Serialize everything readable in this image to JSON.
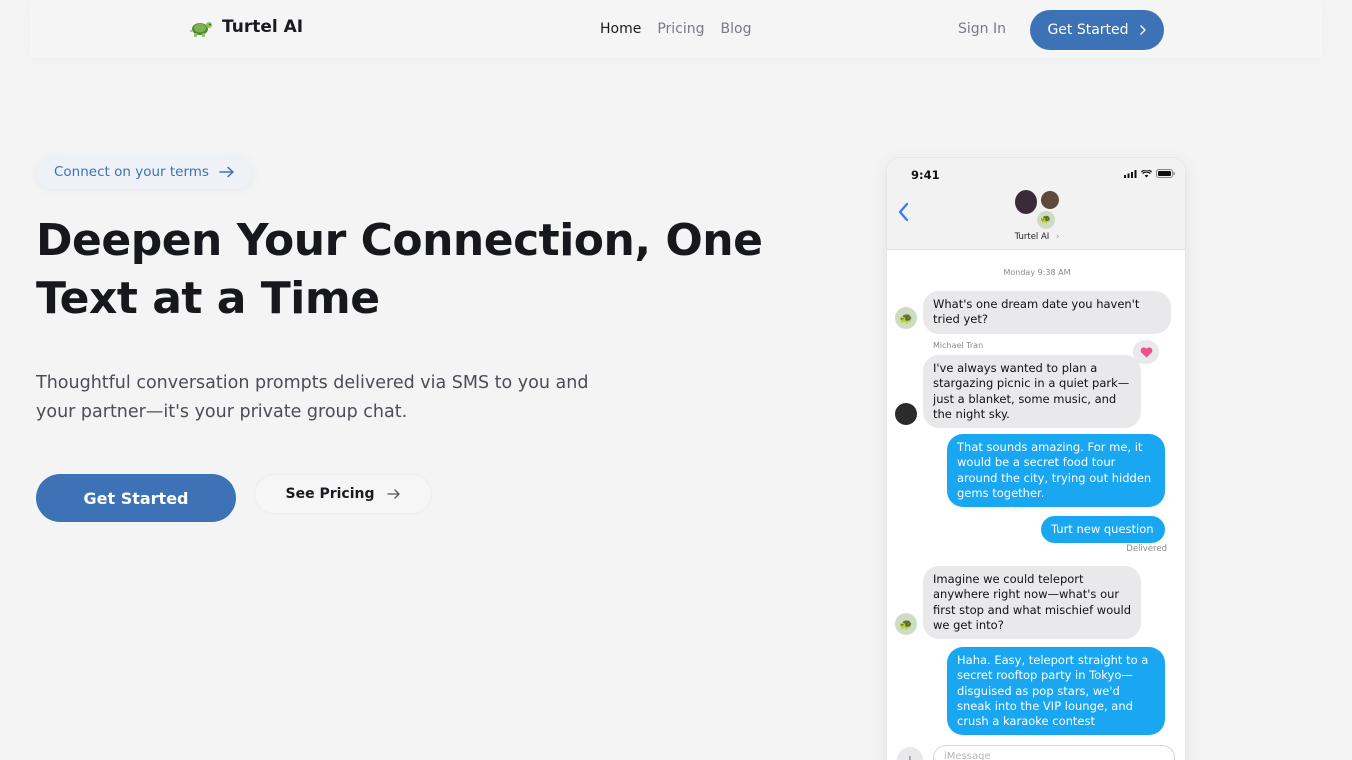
{
  "nav": {
    "brand": "Turtel AI",
    "links": [
      {
        "label": "Home",
        "active": true
      },
      {
        "label": "Pricing",
        "active": false
      },
      {
        "label": "Blog",
        "active": false
      }
    ],
    "sign_in": "Sign In",
    "cta": "Get Started"
  },
  "hero": {
    "pill": "Connect on your terms",
    "headline_line1": "Deepen Your Connection, One",
    "headline_line2": "Text at a Time",
    "subtitle_line1": "Thoughtful conversation prompts delivered via SMS to you and",
    "subtitle_line2": "your partner—it's your private group chat.",
    "primary_cta": "Get Started",
    "secondary_cta": "See Pricing"
  },
  "phone": {
    "time": "9:41",
    "contact_name": "Turtel AI",
    "date_label": "Monday 9:38 AM",
    "messages": [
      {
        "from": "bot",
        "text": "What's one dream date you haven't tried yet?"
      },
      {
        "from": "partner",
        "sender": "Michael Tran",
        "text": "I've always wanted to plan a stargazing picnic in a quiet park—just a blanket, some music, and the night sky.",
        "reaction": "heart"
      },
      {
        "from": "me",
        "text": "That sounds amazing. For me, it would be a secret food tour around the city, trying out hidden gems together."
      },
      {
        "from": "me",
        "text": "Turt new question",
        "status": "Delivered"
      },
      {
        "from": "bot",
        "text": "Imagine we could teleport anywhere right now—what's our first stop and what mischief would we get into?"
      },
      {
        "from": "me",
        "text": "Haha. Easy, teleport straight to a secret rooftop party in Tokyo—disguised as pop stars, we'd sneak into the VIP lounge, and crush a karaoke contest"
      }
    ],
    "input_placeholder": "iMessage"
  },
  "colors": {
    "accent": "#3d72b6",
    "outgoing_bubble": "#1aa7f1",
    "incoming_bubble": "#e9e9eb",
    "background": "#f4f4f5"
  },
  "icons": [
    "turtle-logo-icon",
    "arrow-right-icon",
    "chevron-right-icon",
    "chevron-left-icon",
    "signal-icon",
    "wifi-icon",
    "battery-icon",
    "heart-icon",
    "plus-icon",
    "mic-icon"
  ]
}
